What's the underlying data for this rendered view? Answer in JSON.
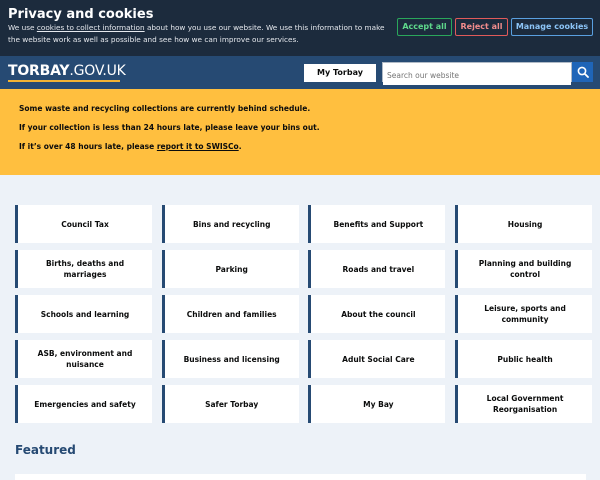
{
  "cookie_banner": {
    "title": "Privacy and cookies",
    "text_before_link": "We use ",
    "link_text": "cookies to collect information",
    "text_after_link": " about how you use our website. We use this information to make the website work as well as possible and see how we can improve our services.",
    "accept_label": "Accept all",
    "reject_label": "Reject all",
    "manage_label": "Manage cookies",
    "colors": {
      "background": "#1c2b3d",
      "accept": "#5ed88b",
      "reject": "#f28c8c",
      "manage": "#8cc4f6"
    }
  },
  "header": {
    "logo_main": "TORBAY",
    "logo_suffix": ".GOV.UK",
    "my_torbay_label": "My Torbay",
    "search": {
      "placeholder": "Search our website",
      "value": "",
      "button_icon": "search-icon"
    },
    "colors": {
      "background": "#264a73",
      "logo_underline": "#f2b233",
      "search_button": "#1f65b8"
    }
  },
  "alert": {
    "line1": "Some waste and recycling collections are currently behind schedule.",
    "line2": "If your collection is less than 24 hours late, please leave your bins out.",
    "line3_before": "If it’s over 48 hours late, please ",
    "line3_link": "report it to SWISCo",
    "line3_after": ".",
    "color": "#ffbf3f"
  },
  "services": [
    "Council Tax",
    "Bins and recycling",
    "Benefits and Support",
    "Housing",
    "Births, deaths and marriages",
    "Parking",
    "Roads and travel",
    "Planning and building control",
    "Schools and learning",
    "Children and families",
    "About the council",
    "Leisure, sports and community",
    "ASB, environment and nuisance",
    "Business and licensing",
    "Adult Social Care",
    "Public health",
    "Emergencies and safety",
    "Safer Torbay",
    "My Bay",
    "Local Government Reorganisation"
  ],
  "featured": {
    "heading": "Featured"
  }
}
